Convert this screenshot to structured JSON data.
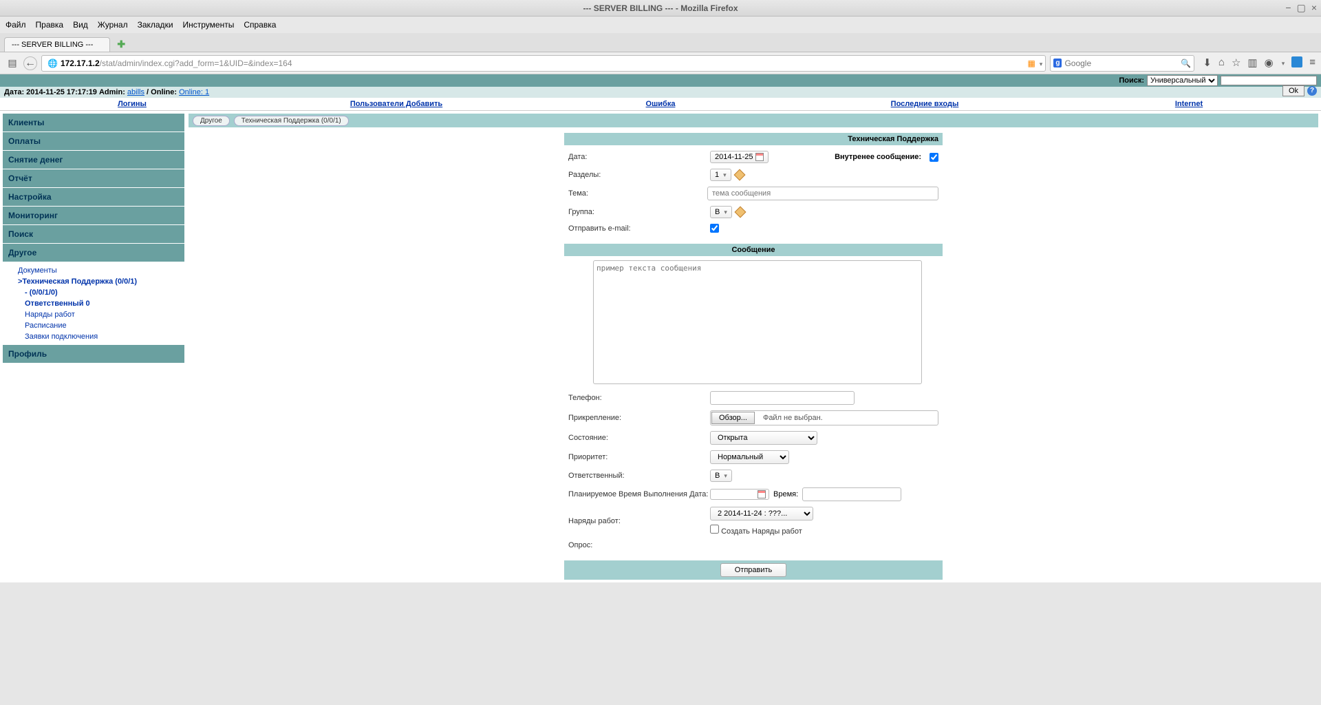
{
  "window": {
    "title": "--- SERVER BILLING --- - Mozilla Firefox"
  },
  "menubar": [
    "Файл",
    "Правка",
    "Вид",
    "Журнал",
    "Закладки",
    "Инструменты",
    "Справка"
  ],
  "tab": {
    "title": "--- SERVER BILLING ---"
  },
  "url": {
    "host": "172.17.1.2",
    "path": "/stat/admin/index.cgi?add_form=1&UID=&index=164"
  },
  "search": {
    "placeholder": "Google"
  },
  "topsearch": {
    "label": "Поиск:",
    "select": "Универсальный"
  },
  "ok_button": "Ok",
  "statusline": {
    "prefix": "Дата: 2014-11-25 17:17:19 Admin: ",
    "admin": "abills",
    "mid": " / Online: ",
    "online": "Online: 1"
  },
  "navlinks": [
    "Логины",
    "Пользователи Добавить",
    "Ошибка",
    "Последние входы",
    "Internet"
  ],
  "sidebar": {
    "items": [
      "Клиенты",
      "Оплаты",
      "Снятие денег",
      "Отчёт",
      "Настройка",
      "Мониторинг",
      "Поиск",
      "Другое",
      "Профиль"
    ],
    "sub": {
      "documents": "Документы",
      "support": ">Техническая Поддержка (0/0/1)",
      "dash": "- (0/0/1/0)",
      "resp": "Ответственный 0",
      "orders": "Наряды работ",
      "schedule": "Расписание",
      "requests": "Заявки подключения"
    }
  },
  "tags": [
    "Другое",
    "Техническая Поддержка (0/0/1)"
  ],
  "form": {
    "title": "Техническая Поддержка",
    "labels": {
      "date": "Дата:",
      "internal": "Внутренее сообщение:",
      "sections": "Разделы:",
      "subject": "Тема:",
      "group": "Группа:",
      "sendmail": "Отправить e-mail:",
      "message": "Сообщение",
      "phone": "Телефон:",
      "attach": "Прикрепление:",
      "state": "Состояние:",
      "priority": "Приоритет:",
      "responsible": "Ответственный:",
      "planned": "Планируемое Время Выполнения Дата:",
      "time": "Время:",
      "work_orders": "Наряды работ:",
      "create_orders": "Создать Наряды работ",
      "poll": "Опрос:",
      "submit": "Отправить"
    },
    "values": {
      "date": "2014-11-25",
      "section_sel": "1",
      "subject_placeholder": "тема сообщения",
      "group_sel": "В",
      "message_placeholder": "пример текста сообщения",
      "browse": "Обзор...",
      "no_file": "Файл не выбран.",
      "state_sel": "Открыта",
      "priority_sel": "Нормальный",
      "resp_sel": "В",
      "orders_sel": "2 2014-11-24 : ???..."
    }
  }
}
